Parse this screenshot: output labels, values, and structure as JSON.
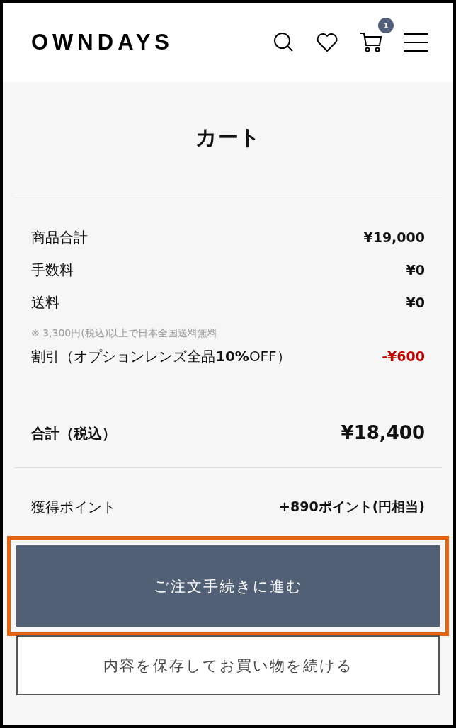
{
  "header": {
    "logo": "OWNDAYS",
    "cart_count": "1"
  },
  "title": "カート",
  "summary": [
    {
      "kind": "row",
      "label": "商品合計",
      "value": "¥19,000"
    },
    {
      "kind": "row",
      "label": "手数料",
      "value": "¥0"
    },
    {
      "kind": "row",
      "label": "送料",
      "value": "¥0"
    },
    {
      "kind": "note",
      "label": "※ 3,300円(税込)以上で日本全国送料無料"
    },
    {
      "kind": "discount",
      "label": "割引（オプションレンズ全品**10%**OFF）",
      "value": "-¥600"
    }
  ],
  "total": {
    "label": "合計（税込）",
    "value": "¥18,400"
  },
  "points": {
    "label": "獲得ポイント",
    "value": "+890ポイント(円相当)"
  },
  "buttons": [
    {
      "kind": "primary",
      "label": "ご注文手続きに進む",
      "highlighted": true
    },
    {
      "kind": "secondary",
      "label": "内容を保存してお買い物を続ける",
      "highlighted": false
    }
  ]
}
